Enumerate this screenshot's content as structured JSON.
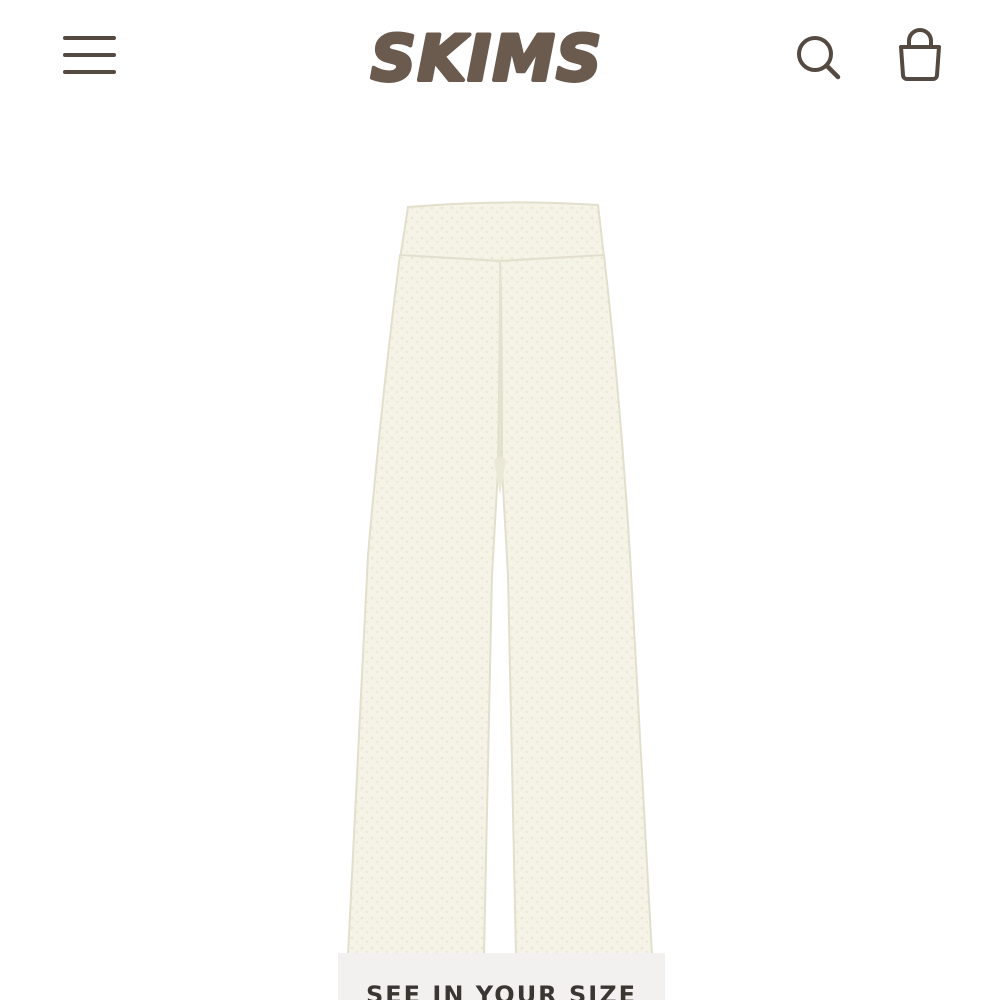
{
  "header": {
    "logo_text": "SKIMS",
    "menu_icon": "hamburger-menu-icon",
    "search_icon": "search-icon",
    "bag_icon": "shopping-bag-icon"
  },
  "product": {
    "see_in_your_size_label": "SEE IN YOUR SIZE"
  },
  "colors": {
    "brand": "#6b5a4e",
    "icon": "#554a42",
    "product_fabric": "#f5f2e6",
    "button_background": "#f2f1ef",
    "button_text": "#3a3632"
  }
}
